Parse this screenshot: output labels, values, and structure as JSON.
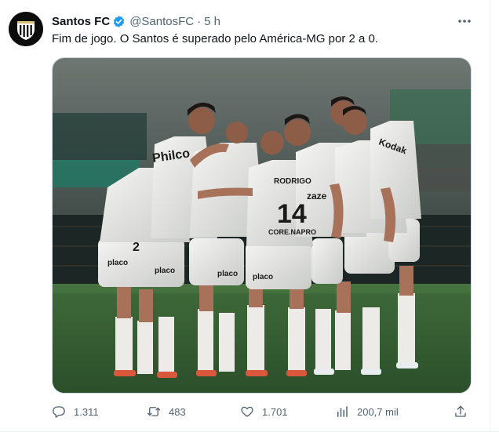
{
  "tweet": {
    "author_name": "Santos FC",
    "handle": "@SantosFC",
    "separator": "·",
    "time": "5 h",
    "text": "Fim de jogo. O Santos é superado pelo América-MG por 2 a 0.",
    "verified": true,
    "verified_color": "#1d9bf0"
  },
  "media": {
    "jersey_texts": [
      "Philco",
      "14",
      "RODRIGO",
      "Kodak",
      "CORE.NAPRO",
      "placo",
      "placo",
      "placo",
      "placo",
      "zaze",
      "2"
    ]
  },
  "metrics": {
    "replies": "1.311",
    "retweets": "483",
    "likes": "1.701",
    "views": "200,7 mil"
  },
  "icons": {
    "more": "more-horizontal-icon",
    "reply": "reply-icon",
    "retweet": "retweet-icon",
    "like": "heart-icon",
    "views": "views-chart-icon",
    "share": "share-icon"
  },
  "colors": {
    "text": "#0f1419",
    "secondary": "#536471",
    "border": "#cfd9de"
  }
}
